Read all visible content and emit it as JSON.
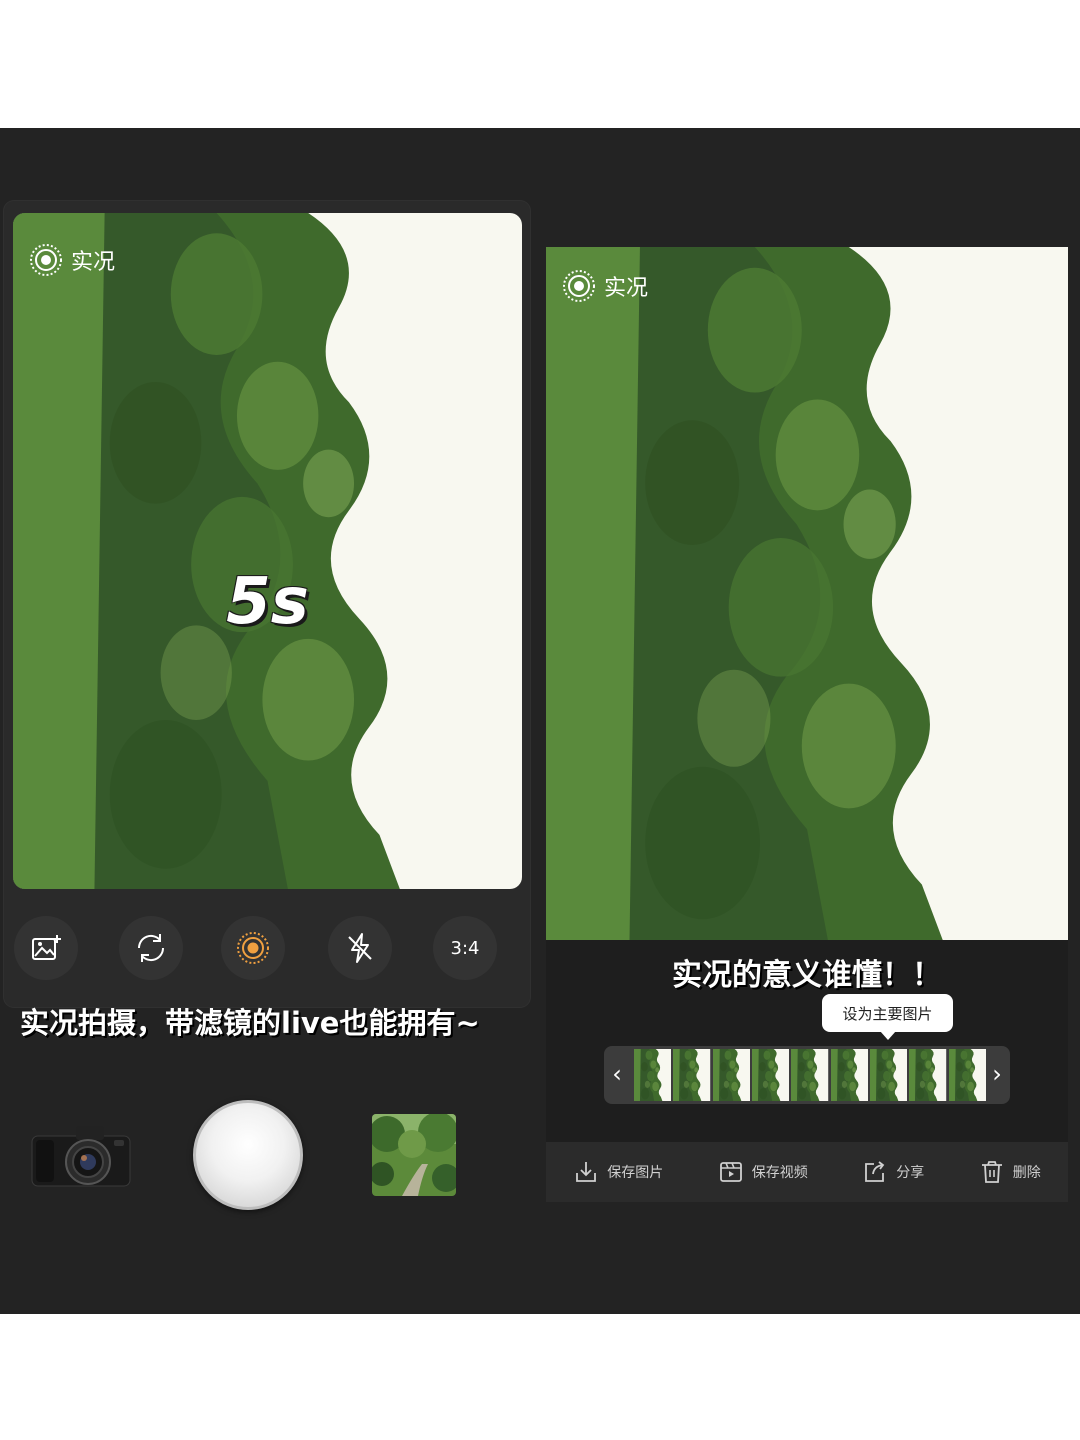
{
  "left_screen": {
    "live_label": "实况",
    "timer_text": "5s",
    "controls": [
      {
        "icon": "gallery-add-icon"
      },
      {
        "icon": "switch-camera-icon"
      },
      {
        "icon": "live-photo-icon"
      },
      {
        "icon": "flash-off-icon"
      },
      {
        "icon": "aspect-ratio",
        "label": "3:4"
      }
    ],
    "caption": "实况拍摄，带滤镜的live也能拥有~"
  },
  "bottom_bar": {
    "camera_icon": "camera-icon",
    "shutter_icon": "shutter-button",
    "gallery_icon": "gallery-thumbnail"
  },
  "right_screen": {
    "live_label": "实况",
    "caption": "实况的意义谁懂！！",
    "tooltip": "设为主要图片",
    "filmstrip": {
      "prev": "‹",
      "next": "›"
    },
    "actions": [
      {
        "icon": "download-icon",
        "label": "保存图片"
      },
      {
        "icon": "video-icon",
        "label": "保存视频"
      },
      {
        "icon": "share-icon",
        "label": "分享"
      },
      {
        "icon": "trash-icon",
        "label": "删除"
      }
    ]
  },
  "colors": {
    "background": "#232323",
    "accent": "#f0a040",
    "sky": "#f7f7ef",
    "foliage": "#4f7a35"
  }
}
